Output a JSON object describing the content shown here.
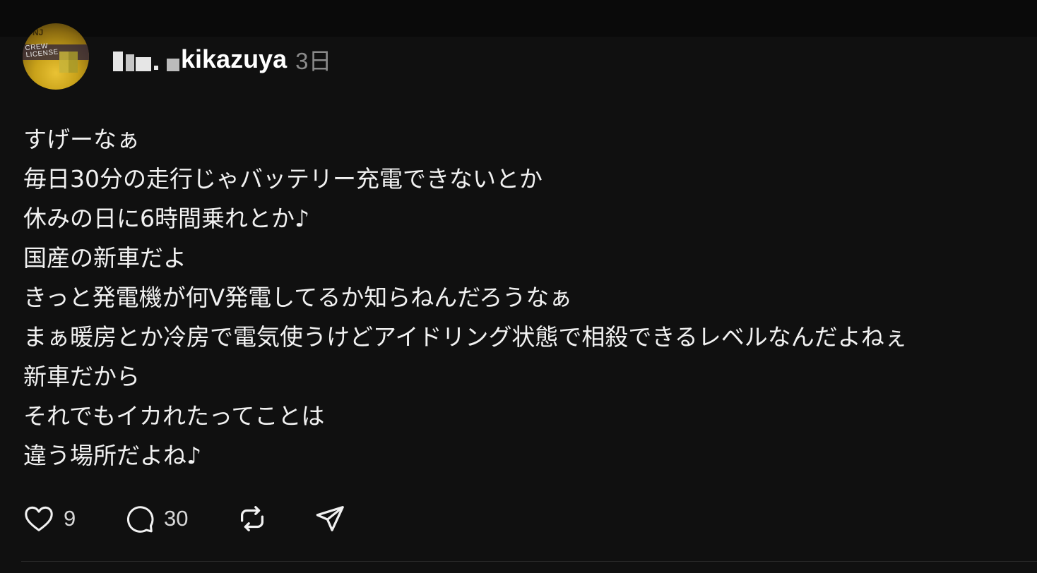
{
  "post": {
    "username": "kikazuya",
    "time_ago": "3日",
    "avatar": {
      "text": "CREW LICENSE",
      "top_letters": "NJ",
      "icon": "avatar-crew-license"
    },
    "body_lines": [
      "すげーなぁ",
      "毎日30分の走行じゃバッテリー充電できないとか",
      "休みの日に6時間乗れとか♪",
      "国産の新車だよ",
      "きっと発電機が何V発電してるか知らねんだろうなぁ",
      "まぁ暖房とか冷房で電気使うけどアイドリング状態で相殺できるレベルなんだよねぇ",
      "新車だから",
      "それでもイカれたってことは",
      "違う場所だよね♪"
    ],
    "actions": {
      "like_count": "9",
      "reply_count": "30",
      "like_icon": "heart-icon",
      "reply_icon": "comment-icon",
      "repost_icon": "repost-icon",
      "share_icon": "send-icon"
    }
  },
  "colors": {
    "background": "#101010",
    "text": "#f1f1f1",
    "muted": "#8a8a8a"
  }
}
